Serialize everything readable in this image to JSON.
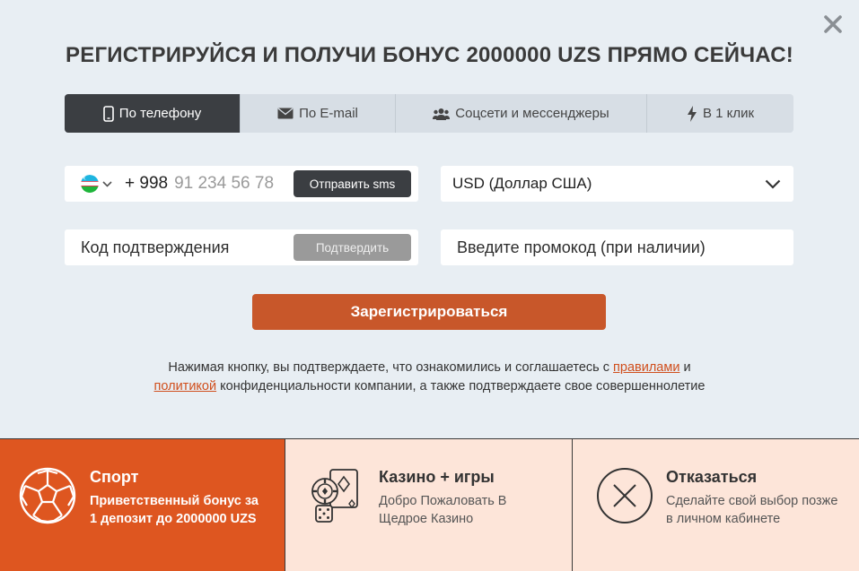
{
  "title": "РЕГИСТРИРУЙСЯ И ПОЛУЧИ БОНУС 2000000 UZS ПРЯМО СЕЙЧАС!",
  "tabs": [
    {
      "label": "По телефону",
      "icon": "phone-icon",
      "active": true
    },
    {
      "label": "По E-mail",
      "icon": "envelope-icon",
      "active": false
    },
    {
      "label": "Соцсети и мессенджеры",
      "icon": "users-icon",
      "active": false
    },
    {
      "label": "В 1 клик",
      "icon": "lightning-icon",
      "active": false
    }
  ],
  "phone": {
    "country_flag": "uzbekistan-flag-icon",
    "prefix": "+ 998",
    "placeholder": "91 234 56 78",
    "send_sms_label": "Отправить sms"
  },
  "currency": {
    "selected": "USD (Доллар США)"
  },
  "code": {
    "placeholder": "Код подтверждения",
    "confirm_label": "Подтвердить"
  },
  "promo": {
    "placeholder": "Введите промокод (при наличии)"
  },
  "register_label": "Зарегистрироваться",
  "legal": {
    "part1": "Нажимая кнопку, вы подтверждаете, что ознакомились и соглашаетесь с ",
    "rules_link": "правилами",
    "part2": " и",
    "policy_link": "политикой",
    "part3": " конфиденциальности компании, а также подтверждаете свое совершеннолетие"
  },
  "bonuses": {
    "sport": {
      "title": "Спорт",
      "description": "Приветственный бонус за 1 депозит до 2000000 UZS",
      "icon": "soccer-ball-icon"
    },
    "casino": {
      "title": "Казино + игры",
      "description": "Добро Пожаловать В Щедрое Казино",
      "icon": "casino-chips-cards-icon"
    },
    "decline": {
      "title": "Отказаться",
      "description": "Сделайте свой выбор позже в личном кабинете",
      "icon": "circle-x-icon"
    }
  },
  "colors": {
    "accent": "#de5620",
    "register_button": "#c8572a",
    "dark": "#3b3e42",
    "background": "#e8eef3",
    "bonus_bg": "#fde5d9"
  }
}
